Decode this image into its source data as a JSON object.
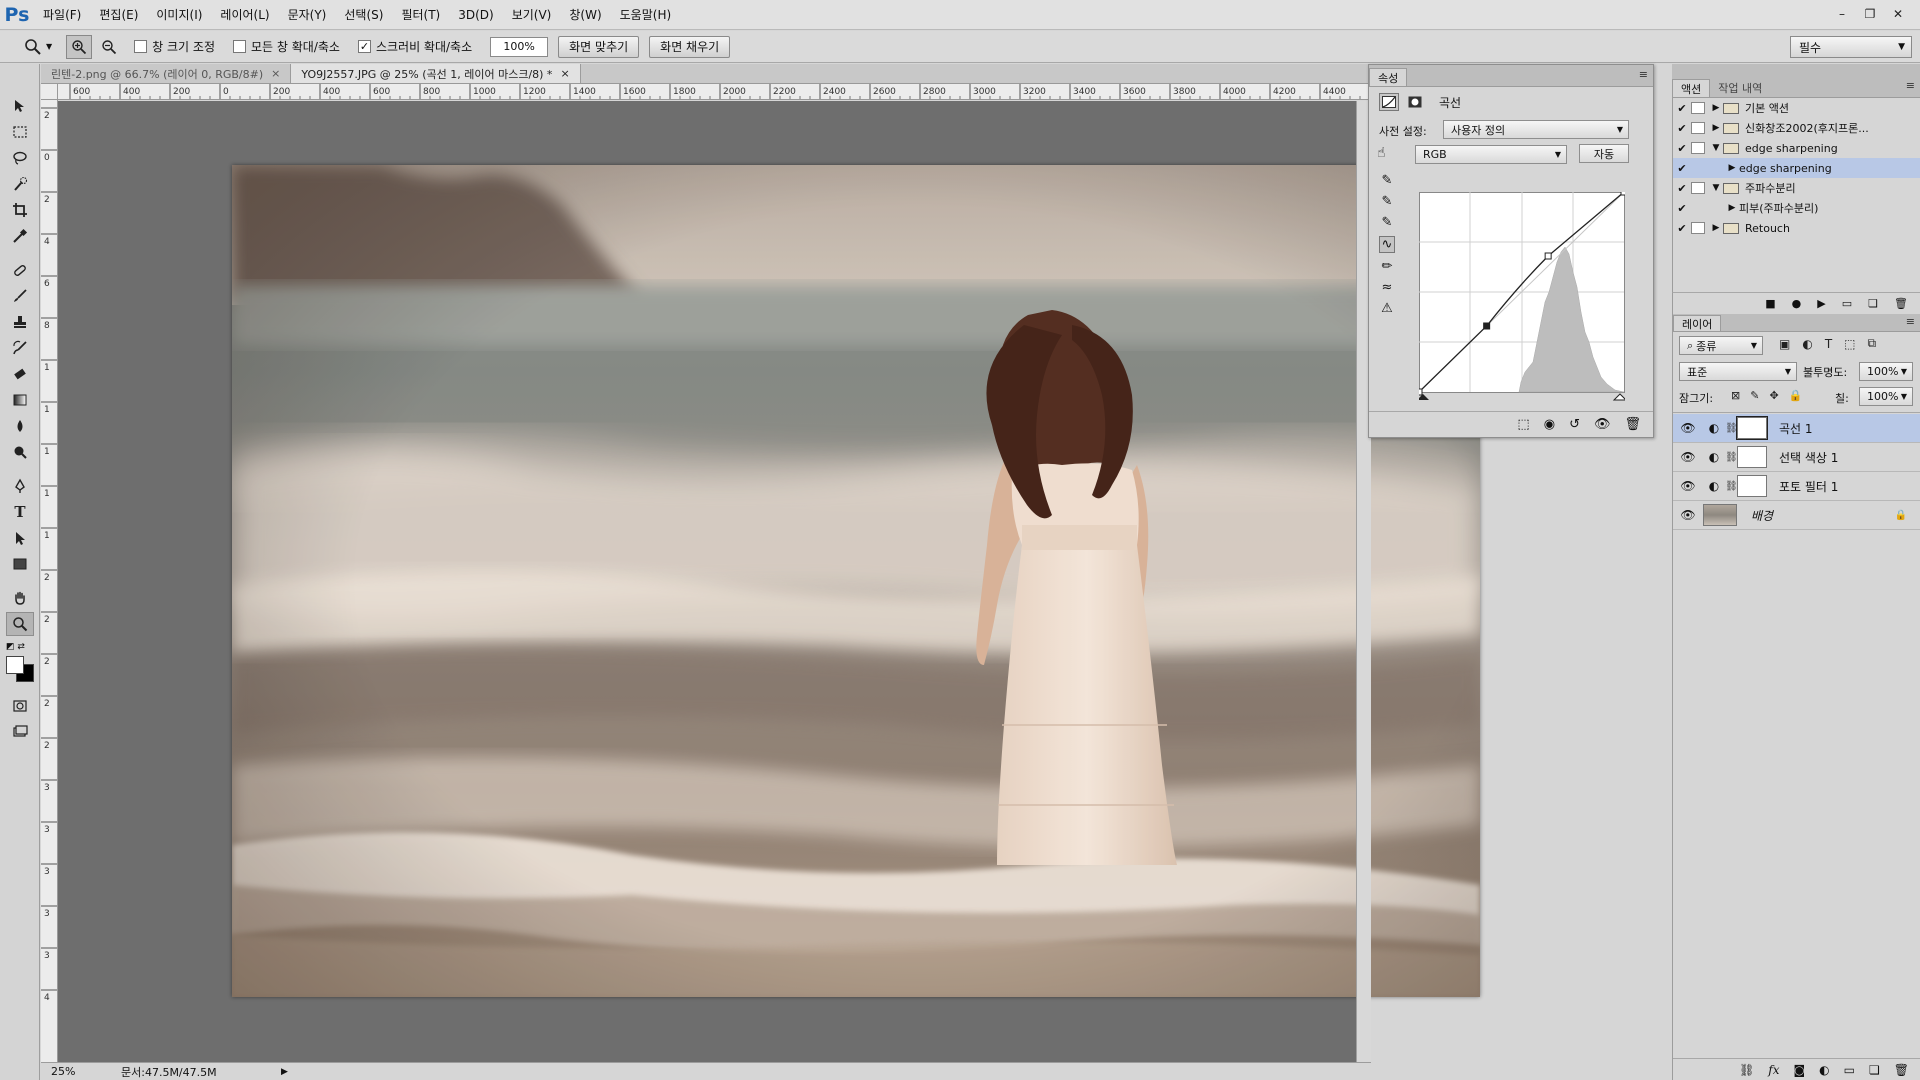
{
  "app": {
    "logo": "Ps"
  },
  "menu": [
    "파일(F)",
    "편집(E)",
    "이미지(I)",
    "레이어(L)",
    "문자(Y)",
    "선택(S)",
    "필터(T)",
    "3D(D)",
    "보기(V)",
    "창(W)",
    "도움말(H)"
  ],
  "window_controls": {
    "minimize": "–",
    "restore": "❐",
    "close": "✕"
  },
  "options": {
    "resize_windows": "창 크기 조정",
    "zoom_all": "모든 창 확대/축소",
    "scrubby_zoom": "스크러비 확대/축소",
    "zoom_value": "100%",
    "fit_screen": "화면 맞추기",
    "fill_screen": "화면 채우기",
    "workspace": "필수"
  },
  "tabs": [
    {
      "label": "린텐-2.png @ 66.7% (레이어 0, RGB/8#)",
      "close": "×"
    },
    {
      "label": "YO9J2557.JPG @ 25% (곡선 1, 레이어 마스크/8) *",
      "close": "×"
    }
  ],
  "ruler_h": [
    "600",
    "400",
    "200",
    "0",
    "200",
    "400",
    "600",
    "800",
    "1000",
    "1200",
    "1400",
    "1600",
    "1800",
    "2000",
    "2200",
    "2400",
    "2600",
    "2800",
    "3000",
    "3200",
    "3400",
    "3600",
    "3800",
    "4000",
    "4200",
    "4400"
  ],
  "ruler_v": [
    "2",
    "0",
    "2",
    "4",
    "6",
    "8",
    "1",
    "1",
    "1",
    "1",
    "1",
    "2",
    "2",
    "2",
    "2",
    "2",
    "3",
    "3",
    "3",
    "3",
    "3",
    "4"
  ],
  "status": {
    "zoom": "25%",
    "doc": "문서:47.5M/47.5M"
  },
  "properties": {
    "tab": "속성",
    "title": "곡선",
    "preset_label": "사전 설정:",
    "preset_value": "사용자 정의",
    "channel": "RGB",
    "auto_button": "자동",
    "curve_points": [
      [
        0,
        0
      ],
      [
        0.33,
        0.33
      ],
      [
        0.63,
        0.68
      ],
      [
        1,
        1
      ]
    ]
  },
  "actions_panel": {
    "tabs": [
      "액션",
      "작업 내역"
    ],
    "items": [
      {
        "label": "기본 액션",
        "checked": true,
        "expanded": false,
        "indent": 0,
        "selected": false
      },
      {
        "label": "신화창조2002(후지프론...",
        "checked": true,
        "expanded": false,
        "indent": 0,
        "selected": false
      },
      {
        "label": "edge sharpening",
        "checked": true,
        "expanded": true,
        "indent": 0,
        "selected": false
      },
      {
        "label": "edge sharpening",
        "checked": true,
        "expanded": false,
        "indent": 1,
        "selected": true
      },
      {
        "label": "주파수분리",
        "checked": true,
        "expanded": true,
        "indent": 0,
        "selected": false
      },
      {
        "label": "피부(주파수분리)",
        "checked": true,
        "expanded": false,
        "indent": 1,
        "selected": false
      },
      {
        "label": "Retouch",
        "checked": true,
        "expanded": false,
        "indent": 0,
        "selected": false
      }
    ]
  },
  "layers_panel": {
    "tab": "레이어",
    "filter_kind": "종류",
    "blend_mode": "표준",
    "opacity_label": "불투명도:",
    "opacity": "100%",
    "lock_label": "잠그기:",
    "fill_label": "칠:",
    "fill": "100%",
    "layers": [
      {
        "name": "곡선 1",
        "type": "adjustment",
        "selected": true
      },
      {
        "name": "선택 색상 1",
        "type": "adjustment",
        "selected": false
      },
      {
        "name": "포토 필터 1",
        "type": "adjustment",
        "selected": false
      },
      {
        "name": "배경",
        "type": "background",
        "selected": false
      }
    ],
    "footer_icons": [
      "link-icon",
      "fx-icon",
      "mask-icon",
      "adjustment-icon",
      "group-icon",
      "new-layer-icon",
      "trash-icon"
    ]
  }
}
